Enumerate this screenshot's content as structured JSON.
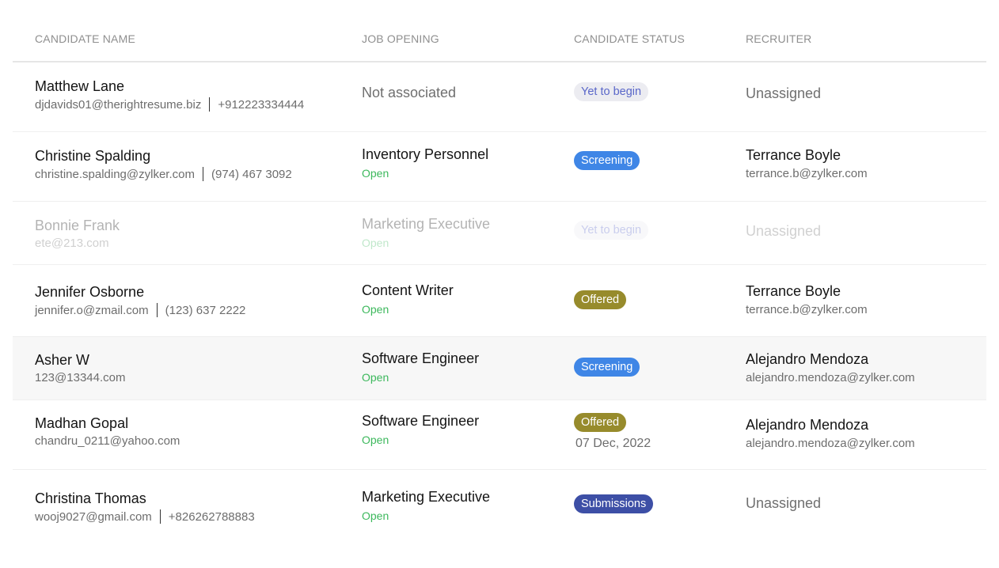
{
  "columns": {
    "candidate": "CANDIDATE NAME",
    "job": "JOB OPENING",
    "status": "CANDIDATE STATUS",
    "recruiter": "RECRUITER"
  },
  "rows": [
    {
      "name": "Matthew Lane",
      "email": "djdavids01@therightresume.biz",
      "phone": "+912223334444",
      "job_title": "Not associated",
      "job_status": "",
      "status": "Yet to begin",
      "status_date": "",
      "recruiter_name": "Unassigned",
      "recruiter_email": ""
    },
    {
      "name": "Christine Spalding",
      "email": "christine.spalding@zylker.com",
      "phone": "(974) 467 3092",
      "job_title": "Inventory Personnel",
      "job_status": "Open",
      "status": "Screening",
      "status_date": "",
      "recruiter_name": "Terrance Boyle",
      "recruiter_email": "terrance.b@zylker.com"
    },
    {
      "name": "Bonnie Frank",
      "email": "ete@213.com",
      "phone": "",
      "job_title": "Marketing Executive",
      "job_status": "Open",
      "status": "Yet to begin",
      "status_date": "",
      "recruiter_name": "Unassigned",
      "recruiter_email": ""
    },
    {
      "name": "Jennifer Osborne",
      "email": "jennifer.o@zmail.com",
      "phone": "(123) 637 2222",
      "job_title": "Content Writer",
      "job_status": "Open",
      "status": "Offered",
      "status_date": "",
      "recruiter_name": "Terrance Boyle",
      "recruiter_email": "terrance.b@zylker.com"
    },
    {
      "name": "Asher W",
      "email": "123@13344.com",
      "phone": "",
      "job_title": "Software Engineer",
      "job_status": "Open",
      "status": "Screening",
      "status_date": "",
      "recruiter_name": "Alejandro Mendoza",
      "recruiter_email": "alejandro.mendoza@zylker.com"
    },
    {
      "name": "Madhan Gopal",
      "email": "chandru_0211@yahoo.com",
      "phone": "",
      "job_title": "Software Engineer",
      "job_status": "Open",
      "status": "Offered",
      "status_date": "07 Dec, 2022",
      "recruiter_name": "Alejandro Mendoza",
      "recruiter_email": "alejandro.mendoza@zylker.com"
    },
    {
      "name": "Christina Thomas",
      "email": "wooj9027@gmail.com",
      "phone": "+826262788883",
      "job_title": "Marketing Executive",
      "job_status": "Open",
      "status": "Submissions",
      "status_date": "",
      "recruiter_name": "Unassigned",
      "recruiter_email": ""
    }
  ],
  "colors": {
    "screening": "#3f86e6",
    "offered": "#978b2c",
    "submissions": "#3d4fa6",
    "yet_to_begin_bg": "#ececf1",
    "yet_to_begin_text": "#5a67c9",
    "open": "#3cb85c"
  }
}
